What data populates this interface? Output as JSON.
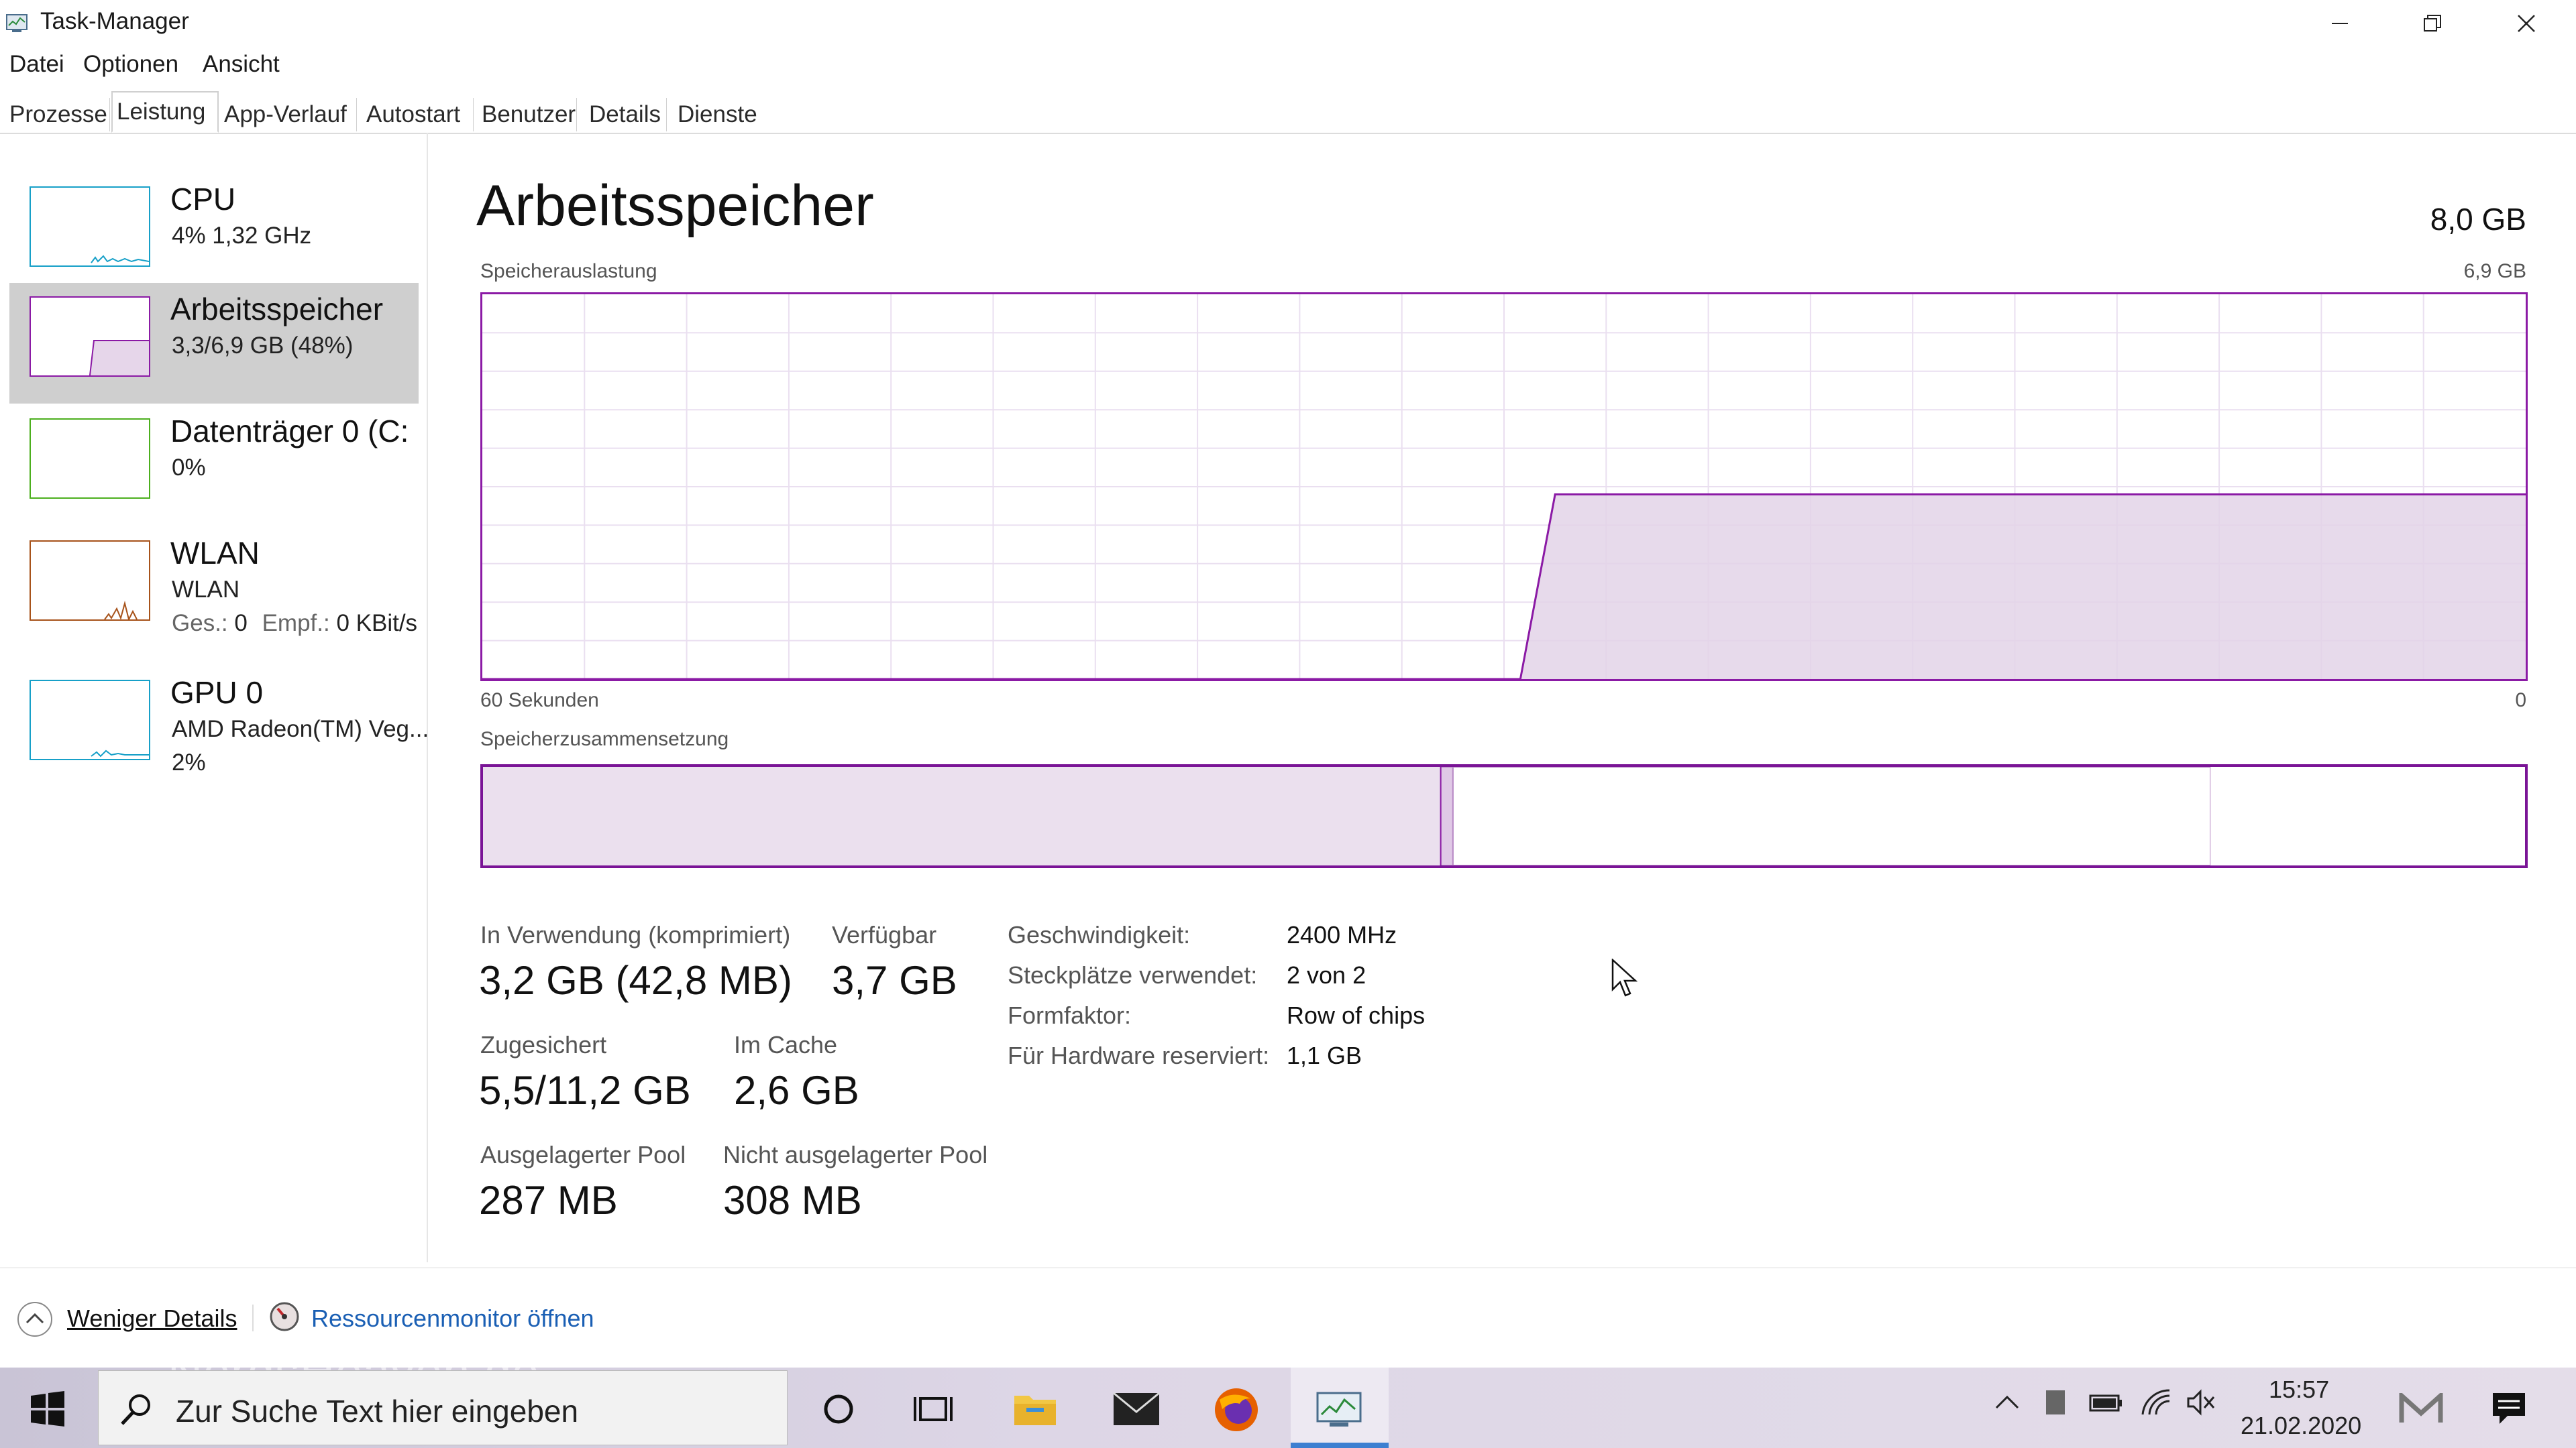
{
  "window": {
    "title": "Task-Manager",
    "icons": {
      "app": "task-manager-icon",
      "minimize": "minimize-icon",
      "restore": "restore-icon",
      "close": "close-icon"
    }
  },
  "menu": {
    "items": [
      "Datei",
      "Optionen",
      "Ansicht"
    ]
  },
  "tabs": [
    "Prozesse",
    "Leistung",
    "App-Verlauf",
    "Autostart",
    "Benutzer",
    "Details",
    "Dienste"
  ],
  "active_tab": "Leistung",
  "sidebar": {
    "items": [
      {
        "title": "CPU",
        "sub1": "4%  1,32 GHz",
        "color": "#17a0c8"
      },
      {
        "title": "Arbeitsspeicher",
        "sub1": "3,3/6,9 GB (48%)",
        "color": "#8b1aa5",
        "selected": true
      },
      {
        "title": "Datenträger 0 (C:",
        "sub1": "0%",
        "color": "#4caf1e"
      },
      {
        "title": "WLAN",
        "sub1": "WLAN",
        "sub2_label1": "Ges.:",
        "sub2_value1": "0",
        "sub2_label2": "Empf.:",
        "sub2_value2": "0 KBit/s",
        "color": "#a7521a"
      },
      {
        "title": "GPU 0",
        "sub1": "AMD Radeon(TM) Veg...",
        "sub2": "2%",
        "color": "#17a0c8"
      }
    ]
  },
  "main": {
    "title": "Arbeitsspeicher",
    "total": "8,0 GB",
    "usage_label": "Speicherauslastung",
    "usage_max": "6,9 GB",
    "time_label": "60 Sekunden",
    "usage_min": "0",
    "composition_label": "Speicherzusammensetzung",
    "accent": "#8b1aa5",
    "usage_graph": {
      "x_range_seconds": [
        60,
        0
      ],
      "y_range_gb": [
        0,
        6.9
      ],
      "series": [
        {
          "elapsed_fraction": 0.0,
          "value_fraction": 0.0
        },
        {
          "elapsed_fraction": 0.508,
          "value_fraction": 0.0
        },
        {
          "elapsed_fraction": 0.525,
          "value_fraction": 0.48
        },
        {
          "elapsed_fraction": 1.0,
          "value_fraction": 0.48
        }
      ]
    },
    "composition_fractions": {
      "in_use": 0.469,
      "modified": 0.006,
      "standby": 0.371,
      "free": 0.154
    }
  },
  "stats": {
    "in_use_label": "In Verwendung (komprimiert)",
    "in_use_value": "3,2 GB (42,8 MB)",
    "available_label": "Verfügbar",
    "available_value": "3,7 GB",
    "committed_label": "Zugesichert",
    "committed_value": "5,5/11,2 GB",
    "cached_label": "Im Cache",
    "cached_value": "2,6 GB",
    "paged_label": "Ausgelagerter Pool",
    "paged_value": "287 MB",
    "nonpaged_label": "Nicht ausgelagerter Pool",
    "nonpaged_value": "308 MB"
  },
  "specs": [
    {
      "label": "Geschwindigkeit:",
      "value": "2400 MHz"
    },
    {
      "label": "Steckplätze verwendet:",
      "value": "2 von 2"
    },
    {
      "label": "Formfaktor:",
      "value": "Row of chips"
    },
    {
      "label": "Für Hardware reserviert:",
      "value": "1,1 GB"
    }
  ],
  "footer": {
    "less_details": "Weniger Details",
    "resmon": "Ressourcenmonitor öffnen"
  },
  "taskbar": {
    "search_placeholder": "Zur Suche Text hier eingeben",
    "watermark": "NerdsHeaven.de",
    "time": "15:57",
    "date": "21.02.2020"
  }
}
